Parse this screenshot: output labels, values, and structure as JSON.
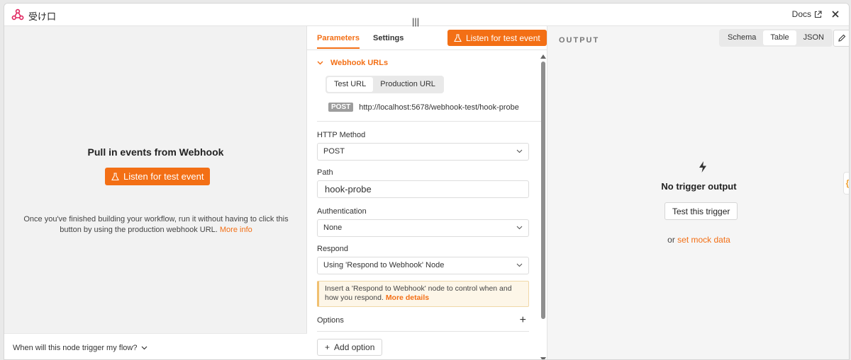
{
  "header": {
    "title": "受け口",
    "docs_label": "Docs"
  },
  "left": {
    "heading": "Pull in events from Webhook",
    "listen_button": "Listen for test event",
    "hint": "Once you've finished building your workflow, run it without having to click this button by using the production webhook URL.",
    "hint_link": "More info",
    "footer_question": "When will this node trigger my flow?"
  },
  "params": {
    "tabs": [
      "Parameters",
      "Settings"
    ],
    "active_tab": "Parameters",
    "listen_button": "Listen for test event",
    "webhook_urls_label": "Webhook URLs",
    "url_tabs": [
      "Test URL",
      "Production URL"
    ],
    "selected_url_tab": "Test URL",
    "method_badge": "POST",
    "url": "http://localhost:5678/webhook-test/hook-probe",
    "http_method_label": "HTTP Method",
    "http_method_value": "POST",
    "path_label": "Path",
    "path_value": "hook-probe",
    "authentication_label": "Authentication",
    "authentication_value": "None",
    "respond_label": "Respond",
    "respond_value": "Using 'Respond to Webhook' Node",
    "notice_text": "Insert a 'Respond to Webhook' node to control when and how you respond.",
    "notice_link": "More details",
    "options_label": "Options",
    "add_option_label": "Add option"
  },
  "output": {
    "label": "OUTPUT",
    "view_tabs": [
      "Schema",
      "Table",
      "JSON"
    ],
    "selected_view": "Table",
    "empty_title": "No trigger output",
    "test_button": "Test this trigger",
    "mock_prefix": "or",
    "mock_link": "set mock data",
    "side_tab": "{"
  },
  "colors": {
    "accent": "#f36f15",
    "logo": "#e0245e"
  }
}
